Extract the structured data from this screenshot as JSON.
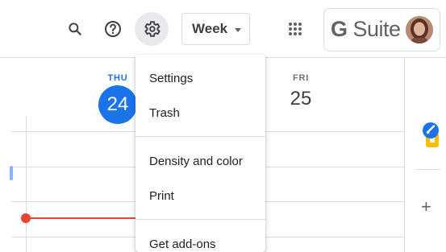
{
  "header": {
    "search_icon": "search-icon",
    "help_icon": "help-icon",
    "settings_icon": "gear-icon",
    "view_select": {
      "value": "Week"
    },
    "apps_icon": "apps-grid-icon",
    "brand": {
      "letter": "G",
      "word": " Suite"
    }
  },
  "calendar": {
    "days": [
      {
        "dow": "THU",
        "date": "24",
        "today": true
      },
      {
        "dow": "FRI",
        "date": "25",
        "today": false
      }
    ]
  },
  "menu": {
    "items": [
      "Settings",
      "Trash",
      "Density and color",
      "Print",
      "Get add-ons"
    ]
  },
  "side_panel": {
    "icons": [
      "keep-icon",
      "tasks-icon",
      "add-icon"
    ]
  },
  "colors": {
    "accent": "#1a73e8",
    "now_line": "#ea4335",
    "keep": "#fbbc04"
  }
}
